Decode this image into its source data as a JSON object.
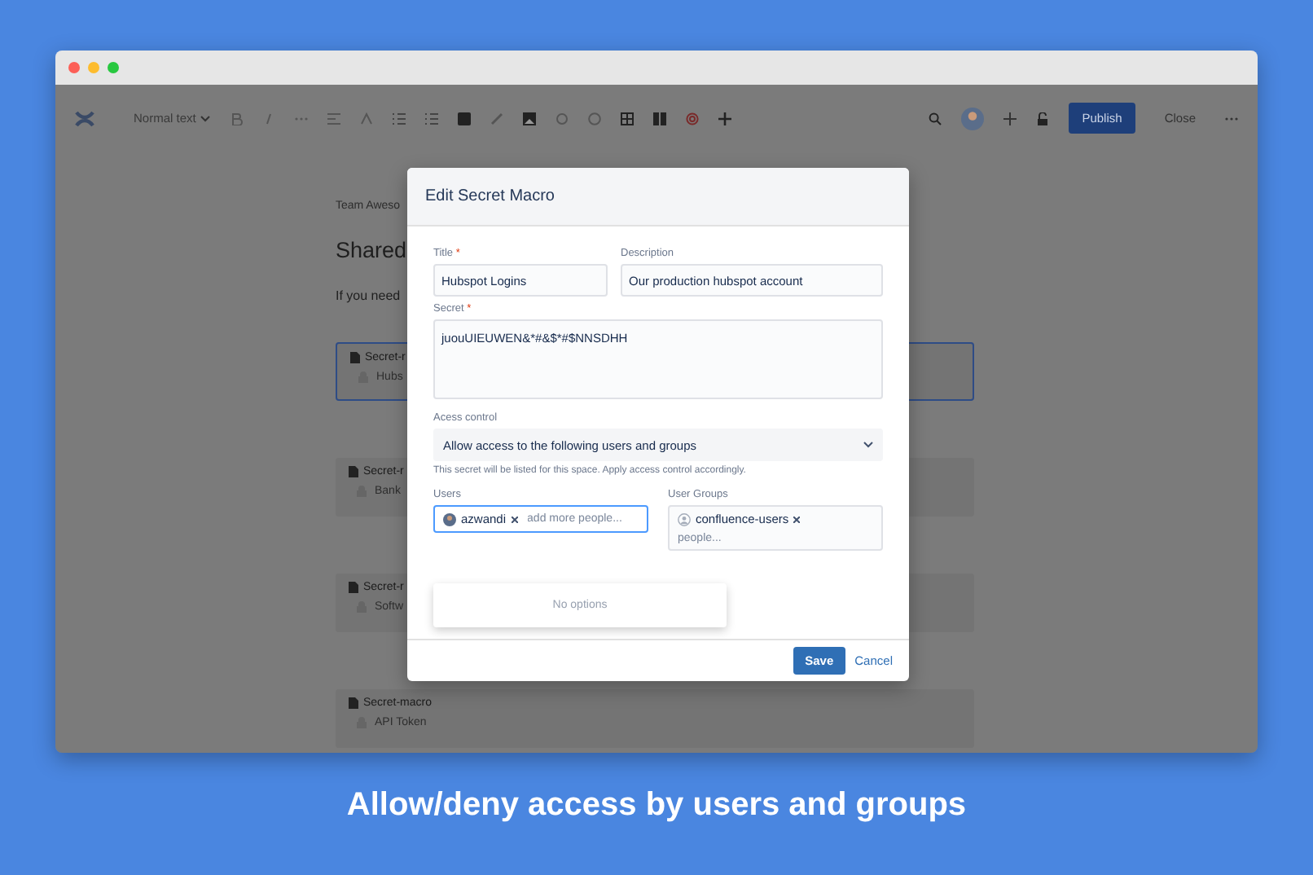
{
  "toolbar": {
    "text_style": "Normal text",
    "publish": "Publish",
    "close": "Close"
  },
  "page": {
    "breadcrumb": "Team Aweso",
    "heading": "Shared",
    "intro": "If you need",
    "macros": [
      {
        "title": "Secret-r",
        "value": "Hubs",
        "selected": true
      },
      {
        "title": "Secret-r",
        "value": "Bank",
        "selected": false
      },
      {
        "title": "Secret-r",
        "value": "Softw",
        "selected": false
      },
      {
        "title": "Secret-macro",
        "value": "API Token",
        "selected": false
      }
    ]
  },
  "dialog": {
    "title": "Edit Secret Macro",
    "title_field": {
      "label": "Title",
      "required_mark": "*",
      "value": "Hubspot Logins"
    },
    "description": {
      "label": "Description",
      "value": "Our production hubspot account"
    },
    "secret": {
      "label": "Secret",
      "required_mark": "*",
      "value": "juouUIEUWEN&*#&$*#$NNSDHH"
    },
    "access_control": {
      "label": "Acess control",
      "value": "Allow access to the following users and groups",
      "hint": "This secret will be listed for this space. Apply access control accordingly."
    },
    "users": {
      "label": "Users",
      "focused": true,
      "chips": [
        {
          "name": "azwandi"
        }
      ],
      "placeholder": "add more people..."
    },
    "options_menu": {
      "text": "No options"
    },
    "user_groups": {
      "label": "User Groups",
      "focused": false,
      "chips": [
        {
          "name": "confluence-users"
        }
      ],
      "placeholder": "people..."
    },
    "save": "Save",
    "cancel": "Cancel"
  },
  "caption": "Allow/deny access by users and groups"
}
